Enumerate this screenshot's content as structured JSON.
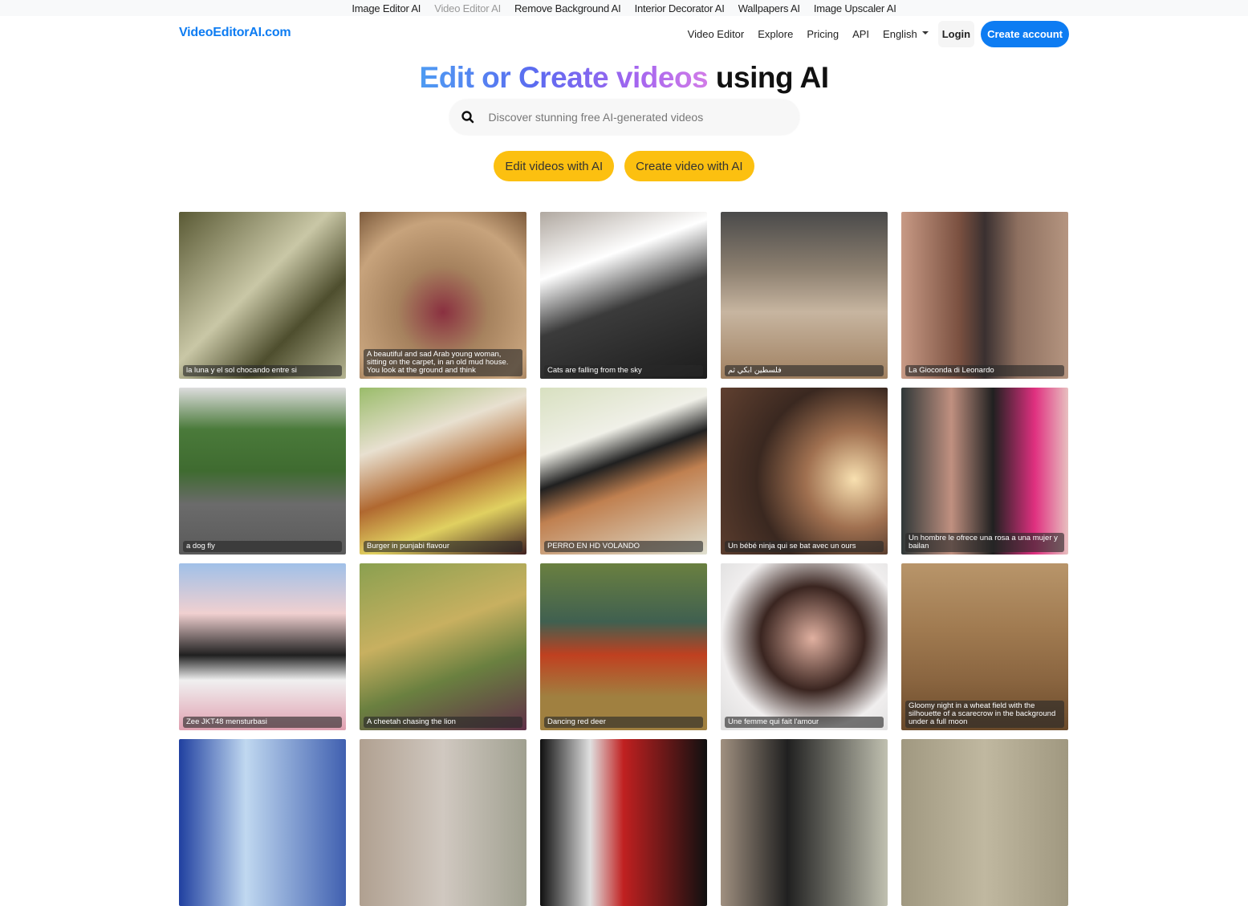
{
  "topbar": {
    "links": [
      {
        "label": "Image Editor AI",
        "active": false
      },
      {
        "label": "Video Editor AI",
        "active": true
      },
      {
        "label": "Remove Background AI",
        "active": false
      },
      {
        "label": "Interior Decorator AI",
        "active": false
      },
      {
        "label": "Wallpapers AI",
        "active": false
      },
      {
        "label": "Image Upscaler AI",
        "active": false
      }
    ]
  },
  "navbar": {
    "brand": "VideoEditorAI.com",
    "links": [
      "Video Editor",
      "Explore",
      "Pricing",
      "API"
    ],
    "language": "English",
    "login": "Login",
    "create_account": "Create account"
  },
  "hero": {
    "title_gradient": "Edit or Create videos",
    "title_rest": "using AI",
    "search_placeholder": "Discover stunning free AI-generated videos",
    "buttons": [
      "Edit videos with AI",
      "Create video with AI"
    ]
  },
  "colors": {
    "brand": "#0d7cf2",
    "cta": "#fcc010"
  },
  "gallery": [
    {
      "caption": "la luna y el sol chocando entre si",
      "bg": "linear-gradient(135deg,#5a5a35,#c9c7a6 45%,#4e4e2e 70%,#b5b492)"
    },
    {
      "caption": "A beautiful and sad Arab young woman, sitting on the carpet, in an old mud house. You look at the ground and think",
      "bg": "radial-gradient(circle at 50% 60%,#8a3040 0%,#a6825e 35%,#c7a37c 70%,#7d5b3c)"
    },
    {
      "caption": "Cats are falling from the sky",
      "bg": "linear-gradient(160deg,#b0a8a0,#fff 30%,#3b3b3b 55%,#1c1c1c)"
    },
    {
      "caption": "فلسطين ابكي ثم",
      "bg": "linear-gradient(180deg,#4a4a4a,#8d8070 35%,#c7b5a0 60%,#a08060)"
    },
    {
      "caption": "La Gioconda di Leonardo",
      "bg": "linear-gradient(90deg,#c89a85,#7a5040 35%,#3a3030 50%,#8e7060 70%,#b59580)"
    },
    {
      "caption": "a dog fly",
      "bg": "linear-gradient(180deg,#ddd 0%,#4a7a3a 25%,#3f6b30 50%,#6b6b6b 70%,#5a5a5a)"
    },
    {
      "caption": "Burger in punjabi flavour",
      "bg": "linear-gradient(160deg,#9abc6a,#e8e0d0 30%,#b06830 55%,#e0d060 75%,#402020)"
    },
    {
      "caption": "PERRO EN HD VOLANDO",
      "bg": "linear-gradient(160deg,#d8e0c0,#f0f0e8 30%,#202020 45%,#c08050 60%,#e0e0d0)"
    },
    {
      "caption": "Un bébé ninja qui se bat avec un ours",
      "bg": "radial-gradient(circle at 80% 55%,#f8e0b0,#a07050 30%,#3a2820 60%,#604030)"
    },
    {
      "caption": "Un hombre le ofrece una rosa a una mujer y bailan",
      "bg": "linear-gradient(90deg,#303838,#c09080 30%,#202020 55%,#e03080 80%,#e8c0c0)"
    },
    {
      "caption": "Zee JKT48 mensturbasi",
      "bg": "linear-gradient(180deg,#a0c0e8,#f0d0d0 30%,#202020 55%,#f0f0f0 70%,#e0a0b0)"
    },
    {
      "caption": "A cheetah chasing the lion",
      "bg": "linear-gradient(160deg,#8aa050,#c8b060 40%,#6a8040 65%,#603048)"
    },
    {
      "caption": "Dancing red deer",
      "bg": "linear-gradient(180deg,#6a8040,#406050 35%,#c04020 55%,#a08040 80%)"
    },
    {
      "caption": "Une femme qui fait l'amour",
      "bg": "radial-gradient(circle at 55% 45%,#e0b0a0,#3a2520 40%,#f0eeee 70%,#ddd)"
    },
    {
      "caption": "Gloomy night in a wheat field with the silhouette of a scarecrow in the background under a full moon",
      "bg": "linear-gradient(180deg,#b8956a,#a07a50 40%,#8a6540 70%,#6a4a2a)"
    },
    {
      "caption": "",
      "bg": "linear-gradient(90deg,#2040a0,#c0d8f0 40%,#4060b0)"
    },
    {
      "caption": "",
      "bg": "linear-gradient(90deg,#b0a090,#d0c8c0 50%,#a0a090)"
    },
    {
      "caption": "",
      "bg": "linear-gradient(90deg,#101010,#e0e0e0 30%,#c02020 50%,#101010)"
    },
    {
      "caption": "",
      "bg": "linear-gradient(90deg,#a09080,#202020 40%,#c0c0b0)"
    },
    {
      "caption": "",
      "bg": "linear-gradient(90deg,#a09880,#c0b8a0 50%,#a09880)"
    }
  ]
}
